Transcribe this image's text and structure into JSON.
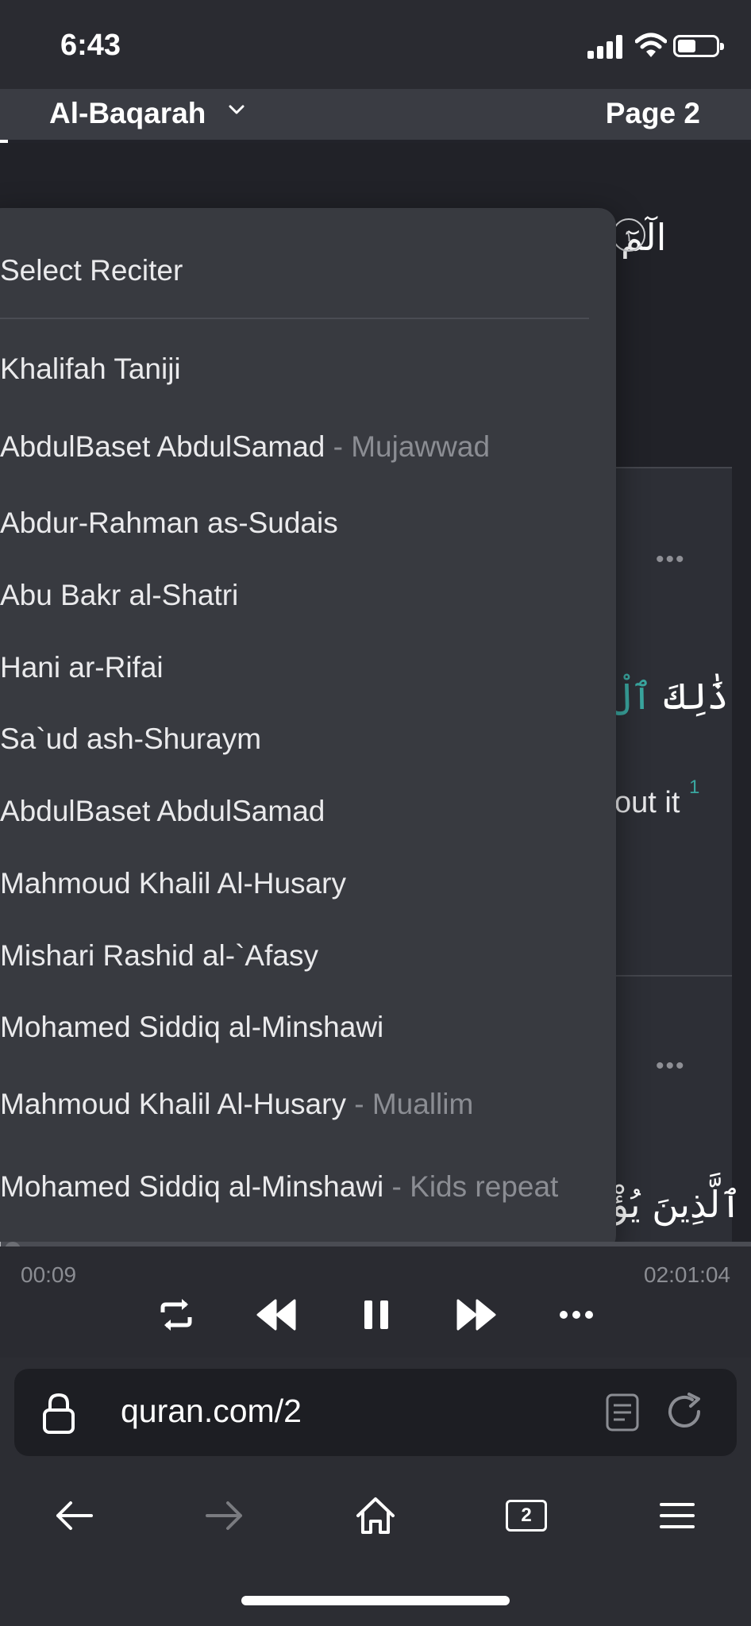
{
  "status_bar": {
    "time": "6:43"
  },
  "header": {
    "surah": "Al-Baqarah",
    "page": "Page 2"
  },
  "reader": {
    "verse1_arabic": "الٓمٓ",
    "verse2_arabic_visible": "ذَٰلِكَ",
    "verse2_arabic_tinted": "ٱلْ",
    "verse2_translation_fragment": "out it",
    "verse2_footnote": "1",
    "verse3_arabic_visible": "ٱلَّذِينَ يُؤْ"
  },
  "dropdown": {
    "title": "Select Reciter",
    "reciters": [
      {
        "name": "Khalifah Taniji",
        "style": ""
      },
      {
        "name": "AbdulBaset AbdulSamad",
        "style": " - Mujawwad"
      },
      {
        "name": "Abdur-Rahman as-Sudais",
        "style": ""
      },
      {
        "name": "Abu Bakr al-Shatri",
        "style": ""
      },
      {
        "name": "Hani ar-Rifai",
        "style": ""
      },
      {
        "name": "Sa`ud ash-Shuraym",
        "style": ""
      },
      {
        "name": "AbdulBaset AbdulSamad",
        "style": ""
      },
      {
        "name": "Mahmoud Khalil Al-Husary",
        "style": ""
      },
      {
        "name": "Mishari Rashid al-`Afasy",
        "style": ""
      },
      {
        "name": "Mohamed Siddiq al-Minshawi",
        "style": ""
      },
      {
        "name": "Mahmoud Khalil Al-Husary",
        "style": " - Muallim"
      },
      {
        "name": "Mohamed Siddiq al-Minshawi",
        "style": " - Kids repeat"
      }
    ]
  },
  "player": {
    "elapsed": "00:09",
    "total": "02:01:04",
    "progress": 0.001
  },
  "browser": {
    "url": "quran.com/2",
    "tab_count": "2"
  },
  "colors": {
    "accent_teal": "#3aa7a0",
    "background": "#212228",
    "dropdown": "#383a40"
  }
}
